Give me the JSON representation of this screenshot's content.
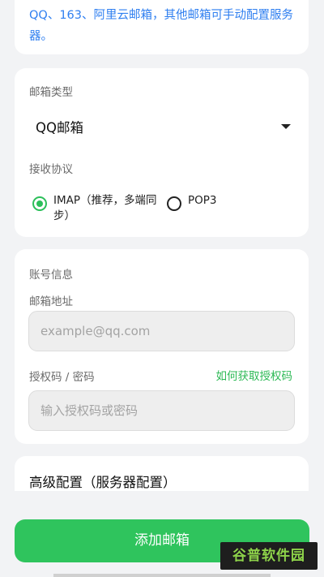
{
  "tip": {
    "text": "QQ、163、阿里云邮箱，其他邮箱可手动配置服务器。"
  },
  "mailbox_type": {
    "label": "邮箱类型",
    "selected": "QQ邮箱",
    "caret_icon": "caret-down-icon"
  },
  "protocol": {
    "label": "接收协议",
    "options": [
      {
        "label": "IMAP（推荐，多端同步）",
        "selected": true
      },
      {
        "label": "POP3",
        "selected": false
      }
    ],
    "accent_color": "#2cbf5a"
  },
  "account": {
    "section_label": "账号信息",
    "email_label": "邮箱地址",
    "email_placeholder": "example@qq.com",
    "password_label": "授权码 / 密码",
    "get_auth_link": "如何获取授权码",
    "password_placeholder": "输入授权码或密码"
  },
  "advanced": {
    "title": "高级配置（服务器配置）"
  },
  "primary_action": {
    "label": "添加邮箱",
    "color": "#2fc45d"
  },
  "watermark": {
    "text": "谷普软件园"
  }
}
